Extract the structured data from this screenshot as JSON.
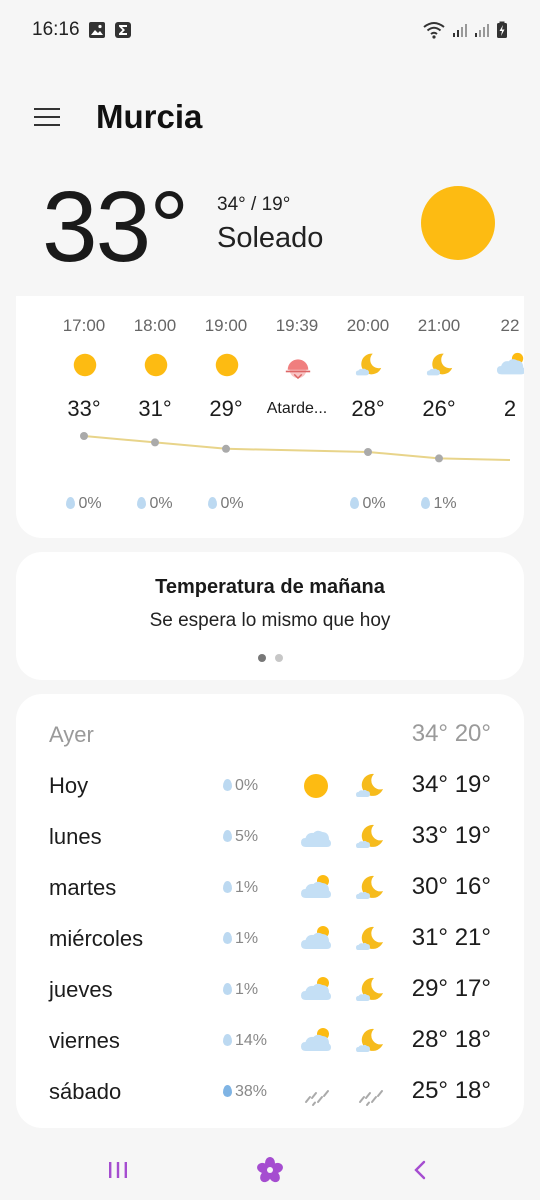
{
  "status": {
    "time": "16:16"
  },
  "header": {
    "city": "Murcia"
  },
  "current": {
    "temp": "33°",
    "range": "34° / 19°",
    "condition": "Soleado"
  },
  "hourly": [
    {
      "time": "17:00",
      "icon": "sun-icon",
      "temp": "33°",
      "precip": "0%"
    },
    {
      "time": "18:00",
      "icon": "sun-icon",
      "temp": "31°",
      "precip": "0%"
    },
    {
      "time": "19:00",
      "icon": "sun-icon",
      "temp": "29°",
      "precip": "0%"
    },
    {
      "time": "19:39",
      "icon": "sunset-icon",
      "temp": "Atarde...",
      "precip": ""
    },
    {
      "time": "20:00",
      "icon": "moon-cloud-icon",
      "temp": "28°",
      "precip": "0%"
    },
    {
      "time": "21:00",
      "icon": "moon-cloud-icon",
      "temp": "26°",
      "precip": "1%"
    },
    {
      "time": "22",
      "icon": "sun-cloud-icon",
      "temp": "2",
      "precip": ""
    }
  ],
  "tomorrow": {
    "title": "Temperatura de mañana",
    "text": "Se espera lo mismo que hoy"
  },
  "daily": [
    {
      "day": "Ayer",
      "precip": "",
      "icon1": "",
      "icon2": "",
      "temps": "34° 20°"
    },
    {
      "day": "Hoy",
      "precip": "0%",
      "icon1": "sun-icon",
      "icon2": "moon-cloud-icon",
      "temps": "34° 19°"
    },
    {
      "day": "lunes",
      "precip": "5%",
      "icon1": "cloud-icon",
      "icon2": "moon-cloud-icon",
      "temps": "33° 19°"
    },
    {
      "day": "martes",
      "precip": "1%",
      "icon1": "sun-cloud-icon",
      "icon2": "moon-cloud-icon",
      "temps": "30° 16°"
    },
    {
      "day": "miércoles",
      "precip": "1%",
      "icon1": "sun-cloud-icon",
      "icon2": "moon-cloud-icon",
      "temps": "31° 21°"
    },
    {
      "day": "jueves",
      "precip": "1%",
      "icon1": "sun-cloud-icon",
      "icon2": "moon-cloud-icon",
      "temps": "29° 17°"
    },
    {
      "day": "viernes",
      "precip": "14%",
      "icon1": "sun-cloud-icon",
      "icon2": "moon-cloud-icon",
      "temps": "28° 18°"
    },
    {
      "day": "sábado",
      "precip": "38%",
      "icon1": "rain-icon",
      "icon2": "rain-icon",
      "temps": "25° 18°"
    }
  ],
  "colors": {
    "sun": "#fdbb12",
    "moon": "#f6bb1c",
    "cloud": "#c4dff5",
    "sunset": "#f07f7f",
    "line": "#e8d48a"
  }
}
